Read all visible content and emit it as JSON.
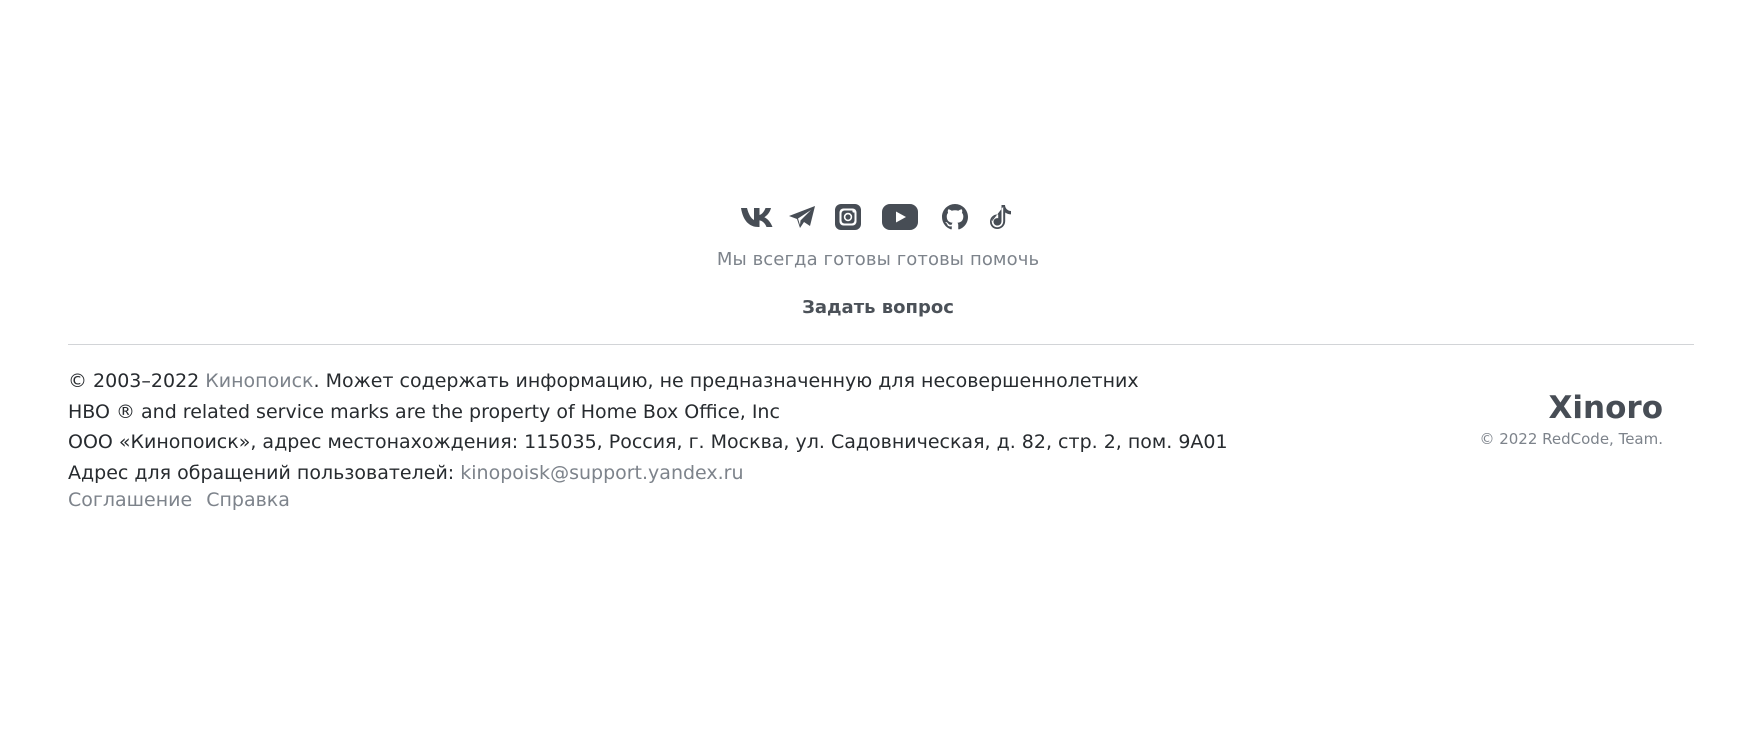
{
  "social": {
    "icons": [
      "vk-icon",
      "telegram-icon",
      "instagram-icon",
      "youtube-icon",
      "github-icon",
      "tiktok-icon"
    ],
    "icon_color": "#474d55"
  },
  "tagline": "Мы всегда готовы готовы помочь",
  "ask_button": "Задать вопрос",
  "legal": {
    "line1_prefix": "© 2003–2022 ",
    "line1_link": "Кинопоиск",
    "line1_suffix": ". Может содержать информацию, не предназначенную для несовершеннолетних",
    "line2": "HBO ® and related service marks are the property of Home Box Office, Inc",
    "line3": "ООО «Кинопоиск», адрес местонахождения: 115035, Россия, г. Москва, ул. Садовническая, д. 82, стр. 2, пом. 9А01",
    "line4_prefix": "Адрес для обращений пользователей: ",
    "line4_email": "kinopoisk@support.yandex.ru"
  },
  "links": {
    "agreement": "Соглашение",
    "help": "Справка"
  },
  "brand": {
    "name": "Xinoro",
    "copyright": "© 2022 RedCode, Team."
  },
  "colors": {
    "text": "#272b2f",
    "muted": "#7d838b",
    "icon": "#474d55",
    "divider": "#d2d4d7"
  }
}
